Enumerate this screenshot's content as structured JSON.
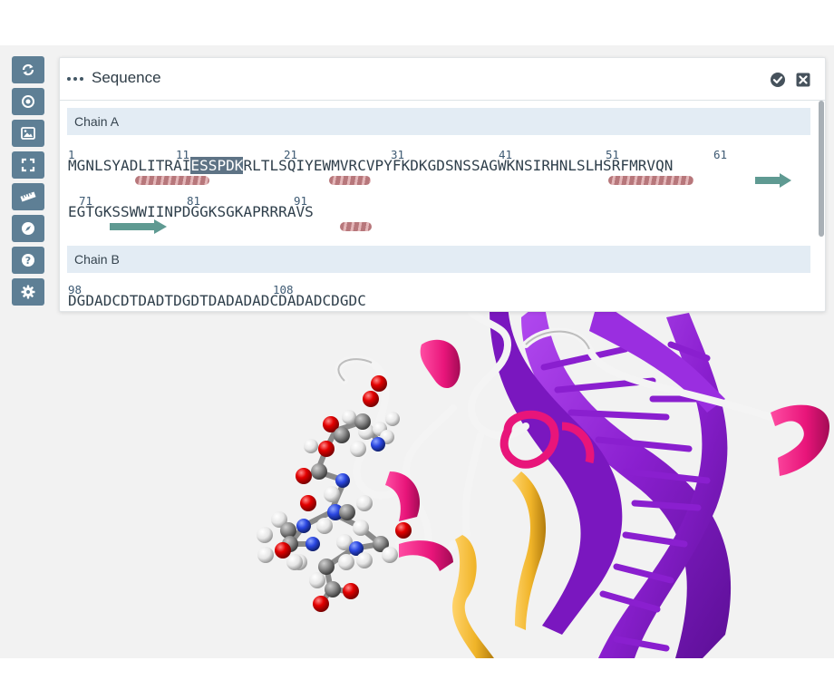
{
  "panel": {
    "title": "Sequence"
  },
  "toolbar": {
    "buttons": [
      {
        "icon": "refresh-icon"
      },
      {
        "icon": "target-icon"
      },
      {
        "icon": "image-icon"
      },
      {
        "icon": "fullscreen-icon"
      },
      {
        "icon": "ruler-icon"
      },
      {
        "icon": "compass-icon"
      },
      {
        "icon": "help-icon"
      },
      {
        "icon": "gear-icon"
      }
    ]
  },
  "chains": [
    {
      "header": "Chain A",
      "lines": [
        {
          "numbers": [
            "1",
            "11",
            "21",
            "31",
            "41",
            "51",
            "61"
          ],
          "sequence_before": "MGNLSYADLITRAI",
          "sequence_highlight": "ESSPDK",
          "sequence_after": "RLTLSQIYEWMVRCVPYFKDKGDSNSSAGWKNSIRHNLSLHSRFMRVQN"
        },
        {
          "numbers": [
            "71",
            "81",
            "91"
          ],
          "sequence_before": "EGTGKSSWWIINPDGGKSGKAPRRRAVS",
          "sequence_highlight": "",
          "sequence_after": ""
        }
      ]
    },
    {
      "header": "Chain B",
      "lines": [
        {
          "numbers": [
            "98",
            "108"
          ],
          "sequence_before": "DGDADCDTDADTDGDTDADADADCDADADCDGDC",
          "sequence_highlight": "",
          "sequence_after": ""
        }
      ]
    }
  ],
  "colors": {
    "toolbar_bg": "#5e7f95",
    "helix": "#b7777b",
    "strand": "#5f9a92",
    "chain_header_bg": "#e3ecf4",
    "dna_ribbon": "#8a1fcf",
    "protein_helix": "#e8157a",
    "protein_strand": "#f0b429",
    "coil": "#f4f4f4"
  }
}
